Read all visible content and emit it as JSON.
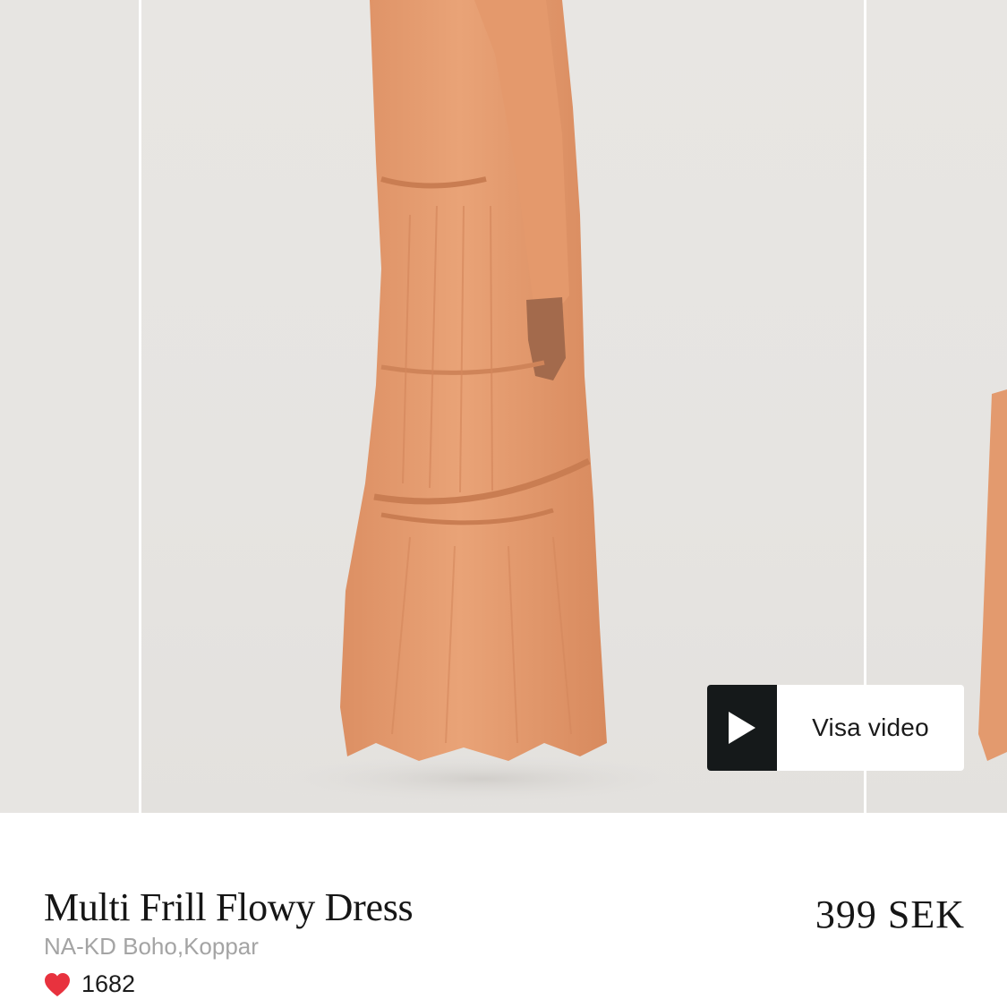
{
  "gallery": {
    "images": [
      {
        "name": "previous-photo"
      },
      {
        "name": "main-photo"
      },
      {
        "name": "next-photo"
      }
    ],
    "video_button": {
      "label": "Visa video",
      "icon": "play-icon"
    }
  },
  "product": {
    "title": "Multi Frill Flowy Dress",
    "subtitle": "NA-KD Boho,Koppar",
    "price": "399 SEK",
    "likes": "1682",
    "like_icon": "heart-icon",
    "colors": {
      "heart": "#e8323e",
      "dress": "#e59a70",
      "text": "#161616",
      "muted": "#a4a4a4"
    }
  }
}
